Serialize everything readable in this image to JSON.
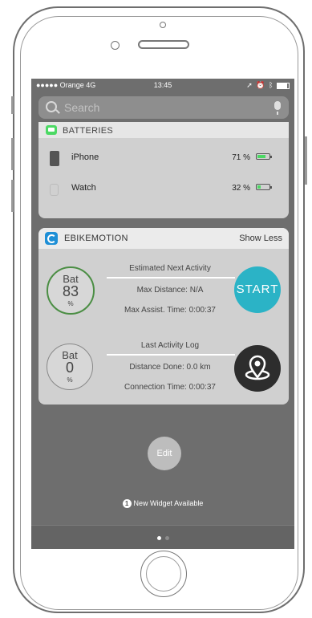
{
  "status_bar": {
    "carrier": "●●●●● Orange  4G",
    "time": "13:45"
  },
  "search": {
    "placeholder": "Search"
  },
  "batteries_widget": {
    "title": "BATTERIES",
    "devices": [
      {
        "name": "iPhone",
        "percent": "71 %",
        "level": 0.71
      },
      {
        "name": "Watch",
        "percent": "32 %",
        "level": 0.32
      }
    ]
  },
  "ebike_widget": {
    "title": "EBIKEMOTION",
    "show_less_label": "Show Less",
    "next_activity": {
      "gauge_label": "Bat",
      "gauge_value": "83",
      "gauge_unit": "%",
      "heading": "Estimated Next Activity",
      "line1": "Max Distance: N/A",
      "line2": "Max Assist. Time: 0:00:37",
      "button_label": "START"
    },
    "last_activity": {
      "gauge_label": "Bat",
      "gauge_value": "0",
      "gauge_unit": "%",
      "heading": "Last Activity Log",
      "line1": "Distance Done: 0.0 km",
      "line2": "Connection Time: 0:00:37"
    }
  },
  "edit_label": "Edit",
  "new_widget": {
    "badge": "1",
    "text": "New Widget Available"
  },
  "page_indicator": {
    "pages": 2,
    "current": 1
  },
  "colors": {
    "start_button": "#2bb3c6",
    "battery_green": "#4cd964",
    "ebike_icon": "#1e8fd6",
    "gauge_active_ring": "#4b8e44"
  }
}
